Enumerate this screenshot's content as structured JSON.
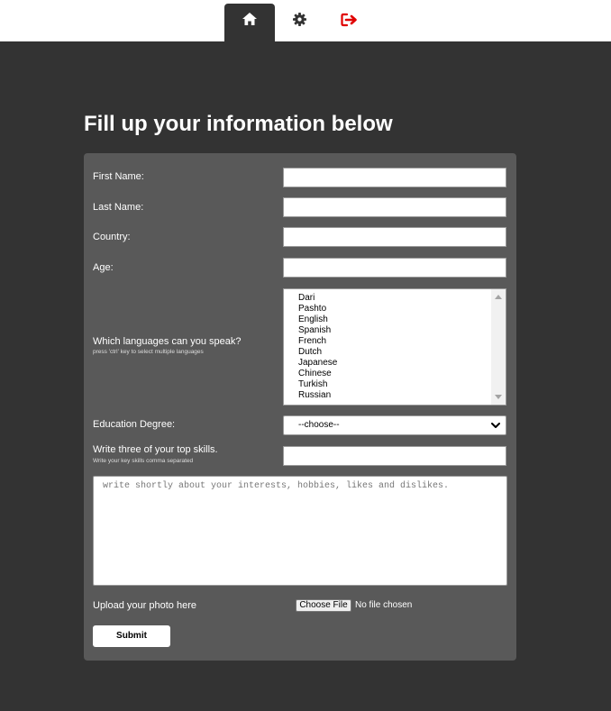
{
  "nav": {
    "home_icon": "home-icon",
    "settings_icon": "gear-icon",
    "logout_icon": "sign-out-icon",
    "logout_color": "#e00000"
  },
  "page": {
    "title": "Fill up your information below"
  },
  "form": {
    "first_name_label": "First Name:",
    "last_name_label": "Last Name:",
    "country_label": "Country:",
    "age_label": "Age:",
    "languages_label": "Which languages can you speak?",
    "languages_hint": "press 'ctrl' key to select multiple languages",
    "languages": [
      "Dari",
      "Pashto",
      "English",
      "Spanish",
      "French",
      "Dutch",
      "Japanese",
      "Chinese",
      "Turkish",
      "Russian"
    ],
    "education_label": "Education Degree:",
    "education_selected": "--choose--",
    "skills_label": "Write three of your top skills.",
    "skills_hint": "Write your key skills comma separated",
    "about_placeholder": "write shortly about your interests, hobbies, likes and dislikes.",
    "photo_label": "Upload your photo here",
    "choose_file_label": "Choose File",
    "file_status": "No file chosen",
    "submit_label": "Submit"
  },
  "colors": {
    "background": "#333333",
    "panel": "#595959",
    "accent_logout": "#e00000"
  }
}
